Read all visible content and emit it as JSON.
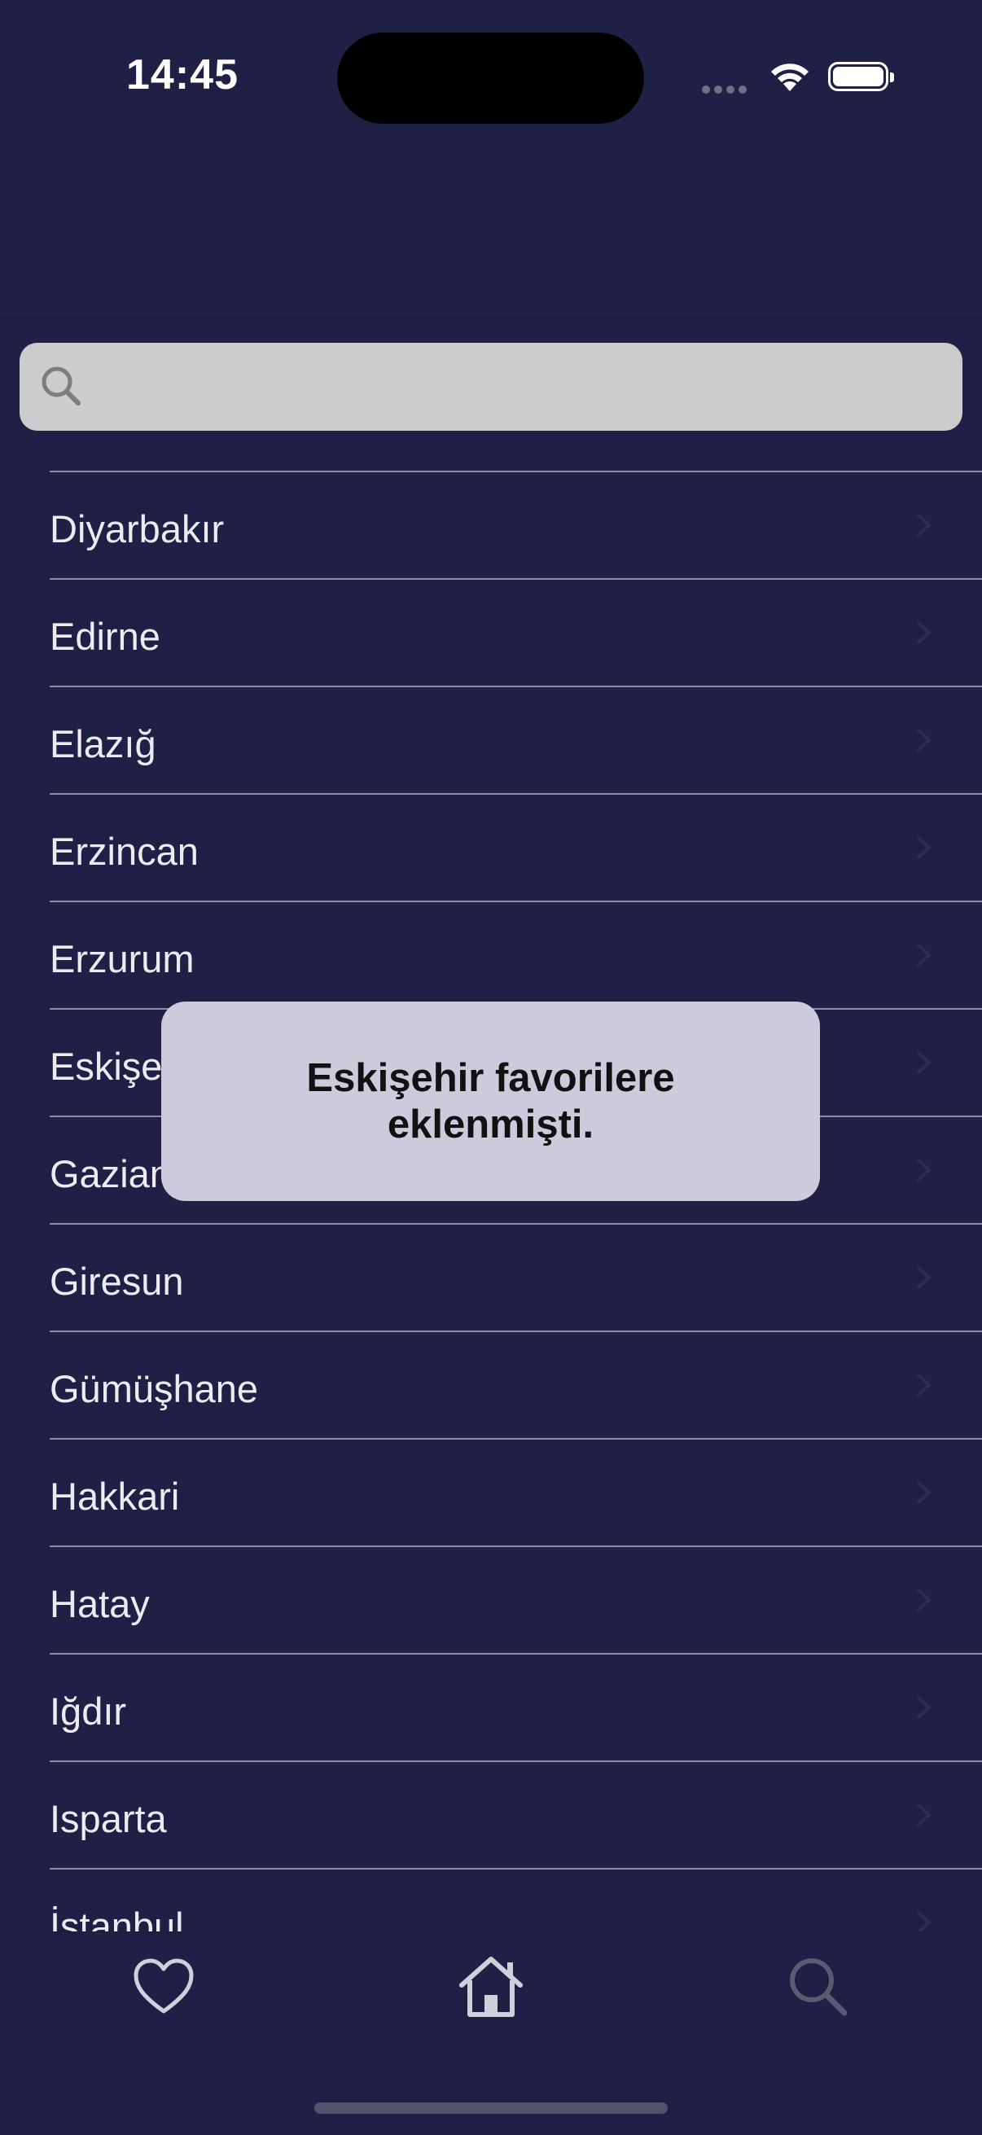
{
  "status_bar": {
    "time": "14:45"
  },
  "search": {
    "placeholder": "",
    "value": ""
  },
  "list": {
    "items": [
      "",
      "Diyarbakır",
      "Edirne",
      "Elazığ",
      "Erzincan",
      "Erzurum",
      "Eskişehir",
      "Gaziantep",
      "Giresun",
      "Gümüşhane",
      "Hakkari",
      "Hatay",
      "Iğdır",
      "Isparta",
      "İstanbul"
    ]
  },
  "toast": {
    "message": "Eskişehir favorilere eklenmişti."
  },
  "tab_bar": {
    "tabs": [
      {
        "name": "favorites",
        "icon": "heart-icon"
      },
      {
        "name": "home",
        "icon": "house-icon"
      },
      {
        "name": "search",
        "icon": "search-icon"
      }
    ]
  },
  "colors": {
    "background": "#201f45",
    "search_field": "#cccccc",
    "toast": "#cdcbdb",
    "separator": "#8d8ca6"
  }
}
